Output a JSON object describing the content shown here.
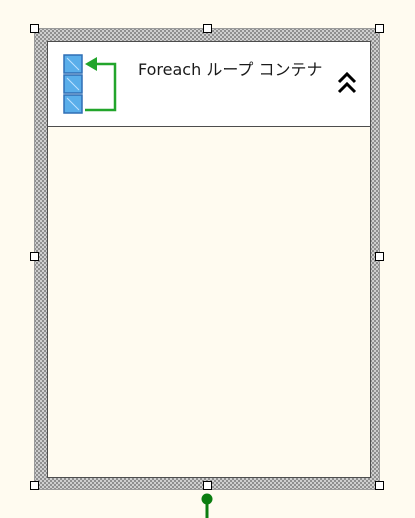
{
  "container": {
    "title": "Foreach ループ コンテナ",
    "icon": "foreach-loop-icon",
    "collapse_icon": "double-chevron-up-icon"
  },
  "colors": {
    "canvas": "#fffbf0",
    "border": "#4d4d4d",
    "icon_blue": "#4da3e8",
    "icon_green": "#22a52b",
    "connector_green": "#0b7d10"
  },
  "precedence_connector": "green-output-arrow"
}
